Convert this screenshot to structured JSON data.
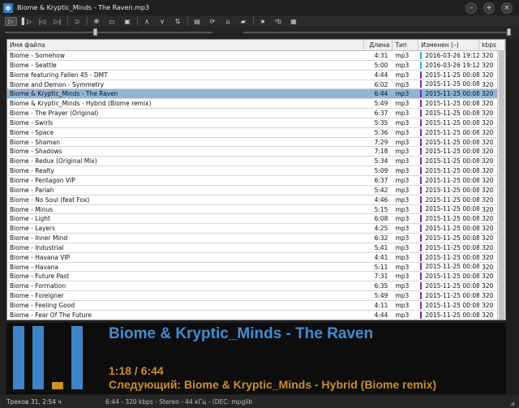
{
  "window": {
    "title": "Biome & Kryptic_Minds - The Raven.mp3",
    "app_icon_glyph": "ф",
    "minimize": "–",
    "maximize": "+",
    "close": "×"
  },
  "toolbar": {
    "buttons": [
      {
        "name": "play-icon",
        "glyph": "▷",
        "active": true
      },
      {
        "name": "pause-icon",
        "glyph": "▌▷"
      },
      {
        "name": "previous-icon",
        "glyph": "|◁"
      },
      {
        "name": "next-icon",
        "glyph": "▷|"
      },
      {
        "name": "repeat-icon",
        "glyph": "⊃"
      },
      {
        "name": "settings-icon",
        "glyph": "✻"
      },
      {
        "name": "mini-window-icon",
        "glyph": "▭"
      },
      {
        "name": "panel-icon",
        "glyph": "▣"
      },
      {
        "name": "move-up-icon",
        "glyph": "∧"
      },
      {
        "name": "move-down-icon",
        "glyph": "∨"
      },
      {
        "name": "sort-icon",
        "glyph": "⇅"
      },
      {
        "name": "columns-icon",
        "glyph": "▤"
      },
      {
        "name": "refresh-icon",
        "glyph": "⟳"
      },
      {
        "name": "home-icon",
        "glyph": "⌂"
      },
      {
        "name": "folder-icon",
        "glyph": "▰"
      },
      {
        "name": "favorite-star-icon",
        "glyph": "★"
      },
      {
        "name": "rename-icon",
        "glyph": "ᵃb"
      },
      {
        "name": "tag-icon",
        "glyph": "▦"
      }
    ]
  },
  "columns": {
    "name": "Имя файла",
    "length": "Длина",
    "type": "Тип",
    "modified": "Изменен (–)",
    "kbps": "kbps"
  },
  "colors": {
    "mod_new": "#2bb5c8",
    "mod_old": "#7a2fa8",
    "selected_row": "#8fb6d8",
    "title_blue": "#3d8fd6",
    "accent_orange": "#c8902a"
  },
  "tracks": [
    {
      "name": "Biome - Somehow",
      "length": "4:31",
      "type": "mp3",
      "modified": "2016-03-26 19:12",
      "kbps": "320",
      "mod": "new"
    },
    {
      "name": "Biome - Seattle",
      "length": "5:00",
      "type": "mp3",
      "modified": "2016-03-26 19:12",
      "kbps": "320",
      "mod": "new"
    },
    {
      "name": "Biome featuring Fallen 45 - DMT",
      "length": "4:44",
      "type": "mp3",
      "modified": "2015-11-25 00:08",
      "kbps": "320",
      "mod": "old"
    },
    {
      "name": "Biome and Demon - Symmetry",
      "length": "6:02",
      "type": "mp3",
      "modified": "2015-11-25 00:08",
      "kbps": "320",
      "mod": "old"
    },
    {
      "name": "Biome & Kryptic_Minds - The Raven",
      "length": "6:44",
      "type": "mp3",
      "modified": "2015-11-25 00:08",
      "kbps": "320",
      "mod": "old",
      "selected": true
    },
    {
      "name": "Biome & Kryptic_Minds - Hybrid (Biome remix)",
      "length": "5:49",
      "type": "mp3",
      "modified": "2015-11-25 00:08",
      "kbps": "320",
      "mod": "old"
    },
    {
      "name": "Biome - The Prayer (Original)",
      "length": "6:37",
      "type": "mp3",
      "modified": "2015-11-25 00:08",
      "kbps": "320",
      "mod": "old"
    },
    {
      "name": "Biome - Swirls",
      "length": "5:35",
      "type": "mp3",
      "modified": "2015-11-25 00:08",
      "kbps": "320",
      "mod": "old"
    },
    {
      "name": "Biome - Space",
      "length": "5:36",
      "type": "mp3",
      "modified": "2015-11-25 00:08",
      "kbps": "320",
      "mod": "old"
    },
    {
      "name": "Biome - Shaman",
      "length": "7:29",
      "type": "mp3",
      "modified": "2015-11-25 00:08",
      "kbps": "320",
      "mod": "old"
    },
    {
      "name": "Biome - Shadows",
      "length": "7:18",
      "type": "mp3",
      "modified": "2015-11-25 00:08",
      "kbps": "320",
      "mod": "old"
    },
    {
      "name": "Biome - Redux (Original Mix)",
      "length": "5:34",
      "type": "mp3",
      "modified": "2015-11-25 00:08",
      "kbps": "320",
      "mod": "old"
    },
    {
      "name": "Biome - Realty",
      "length": "5:09",
      "type": "mp3",
      "modified": "2015-11-25 00:08",
      "kbps": "320",
      "mod": "old"
    },
    {
      "name": "Biome - Pentagon VIP",
      "length": "6:37",
      "type": "mp3",
      "modified": "2015-11-25 00:08",
      "kbps": "320",
      "mod": "old"
    },
    {
      "name": "Biome - Pariah",
      "length": "5:42",
      "type": "mp3",
      "modified": "2015-11-25 00:08",
      "kbps": "320",
      "mod": "old"
    },
    {
      "name": "Biome - No Soul (feat Fox)",
      "length": "4:46",
      "type": "mp3",
      "modified": "2015-11-25 00:08",
      "kbps": "320",
      "mod": "old"
    },
    {
      "name": "Biome - Minus",
      "length": "5:15",
      "type": "mp3",
      "modified": "2015-11-25 00:08",
      "kbps": "320",
      "mod": "old"
    },
    {
      "name": "Biome - Light",
      "length": "6:08",
      "type": "mp3",
      "modified": "2015-11-25 00:08",
      "kbps": "320",
      "mod": "old"
    },
    {
      "name": "Biome - Layers",
      "length": "4:25",
      "type": "mp3",
      "modified": "2015-11-25 00:08",
      "kbps": "320",
      "mod": "old"
    },
    {
      "name": "Biome - Inner Mind",
      "length": "6:32",
      "type": "mp3",
      "modified": "2015-11-25 00:08",
      "kbps": "320",
      "mod": "old"
    },
    {
      "name": "Biome - Industrial",
      "length": "5:41",
      "type": "mp3",
      "modified": "2015-11-25 00:08",
      "kbps": "320",
      "mod": "old"
    },
    {
      "name": "Biome - Havana VIP",
      "length": "4:41",
      "type": "mp3",
      "modified": "2015-11-25 00:08",
      "kbps": "320",
      "mod": "old"
    },
    {
      "name": "Biome - Havana",
      "length": "5:11",
      "type": "mp3",
      "modified": "2015-11-25 00:08",
      "kbps": "320",
      "mod": "old"
    },
    {
      "name": "Biome - Future Past",
      "length": "7:31",
      "type": "mp3",
      "modified": "2015-11-25 00:08",
      "kbps": "320",
      "mod": "old"
    },
    {
      "name": "Biome - Formation",
      "length": "6:35",
      "type": "mp3",
      "modified": "2015-11-25 00:08",
      "kbps": "320",
      "mod": "old"
    },
    {
      "name": "Biome - Foreigner",
      "length": "5:49",
      "type": "mp3",
      "modified": "2015-11-25 00:08",
      "kbps": "320",
      "mod": "old"
    },
    {
      "name": "Biome - Feeling Good",
      "length": "4:11",
      "type": "mp3",
      "modified": "2015-11-25 00:08",
      "kbps": "320",
      "mod": "old"
    },
    {
      "name": "Biome - Fear Of The Future",
      "length": "4:44",
      "type": "mp3",
      "modified": "2015-11-25 00:08",
      "kbps": "320",
      "mod": "old"
    }
  ],
  "now_playing": {
    "title": "Biome & Kryptic_Minds - The Raven",
    "time": "1:18 / 6:44",
    "next": "Следующий: Biome & Kryptic_Minds - Hybrid (Biome remix)",
    "visualizer_levels": [
      1.0,
      1.0,
      0.12,
      1.0
    ]
  },
  "status": {
    "tracks": "Треков 31, 2:54 ч",
    "stream": "6:44 - 320 kbps - Stereo - 44 кГц - (DEC: mpglib"
  }
}
